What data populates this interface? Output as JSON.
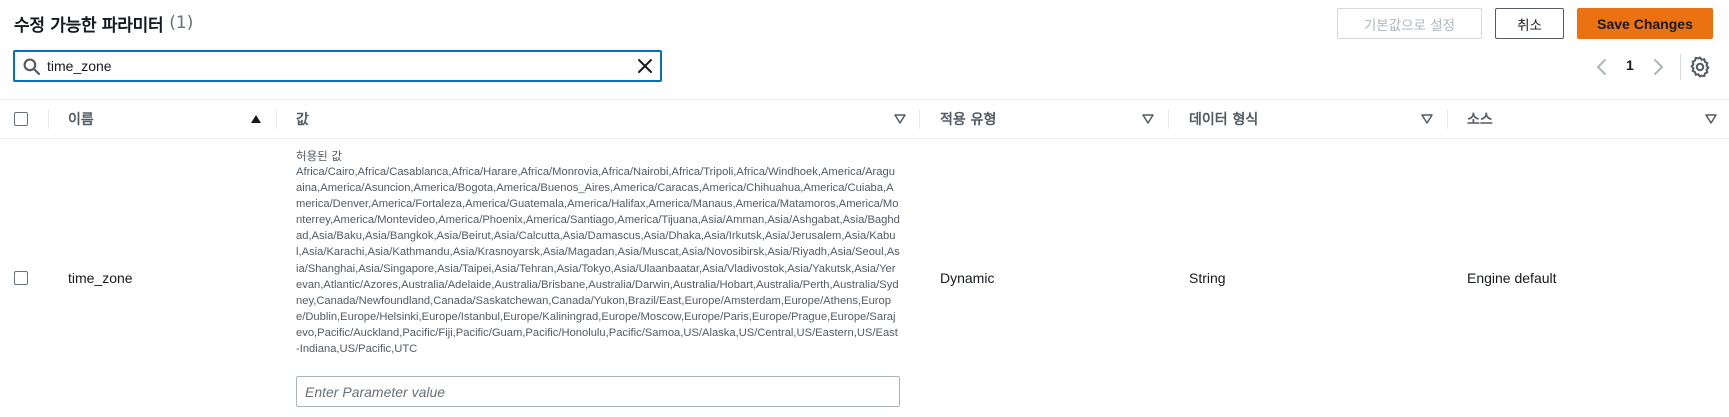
{
  "header": {
    "title": "수정 가능한 파라미터",
    "count": "(1)",
    "reset_label": "기본값으로 설정",
    "cancel_label": "취소",
    "save_label": "Save Changes"
  },
  "search": {
    "value": "time_zone"
  },
  "pagination": {
    "current_page": "1"
  },
  "table": {
    "columns": [
      "이름",
      "값",
      "적용 유형",
      "데이터 형식",
      "소스"
    ],
    "rows": [
      {
        "name": "time_zone",
        "allowed_label": "허용된 값",
        "allowed_values": "Africa/Cairo,Africa/Casablanca,Africa/Harare,Africa/Monrovia,Africa/Nairobi,Africa/Tripoli,Africa/Windhoek,America/Araguaina,America/Asuncion,America/Bogota,America/Buenos_Aires,America/Caracas,America/Chihuahua,America/Cuiaba,America/Denver,America/Fortaleza,America/Guatemala,America/Halifax,America/Manaus,America/Matamoros,America/Monterrey,America/Montevideo,America/Phoenix,America/Santiago,America/Tijuana,Asia/Amman,Asia/Ashgabat,Asia/Baghdad,Asia/Baku,Asia/Bangkok,Asia/Beirut,Asia/Calcutta,Asia/Damascus,Asia/Dhaka,Asia/Irkutsk,Asia/Jerusalem,Asia/Kabul,Asia/Karachi,Asia/Kathmandu,Asia/Krasnoyarsk,Asia/Magadan,Asia/Muscat,Asia/Novosibirsk,Asia/Riyadh,Asia/Seoul,Asia/Shanghai,Asia/Singapore,Asia/Taipei,Asia/Tehran,Asia/Tokyo,Asia/Ulaanbaatar,Asia/Vladivostok,Asia/Yakutsk,Asia/Yerevan,Atlantic/Azores,Australia/Adelaide,Australia/Brisbane,Australia/Darwin,Australia/Hobart,Australia/Perth,Australia/Sydney,Canada/Newfoundland,Canada/Saskatchewan,Canada/Yukon,Brazil/East,Europe/Amsterdam,Europe/Athens,Europe/Dublin,Europe/Helsinki,Europe/Istanbul,Europe/Kaliningrad,Europe/Moscow,Europe/Paris,Europe/Prague,Europe/Sarajevo,Pacific/Auckland,Pacific/Fiji,Pacific/Guam,Pacific/Honolulu,Pacific/Samoa,US/Alaska,US/Central,US/Eastern,US/East-Indiana,US/Pacific,UTC",
        "value_placeholder": "Enter Parameter value",
        "apply_type": "Dynamic",
        "data_type": "String",
        "source": "Engine default"
      }
    ]
  },
  "colors": {
    "accent": "#0073bb",
    "primary_button": "#ec7211"
  }
}
